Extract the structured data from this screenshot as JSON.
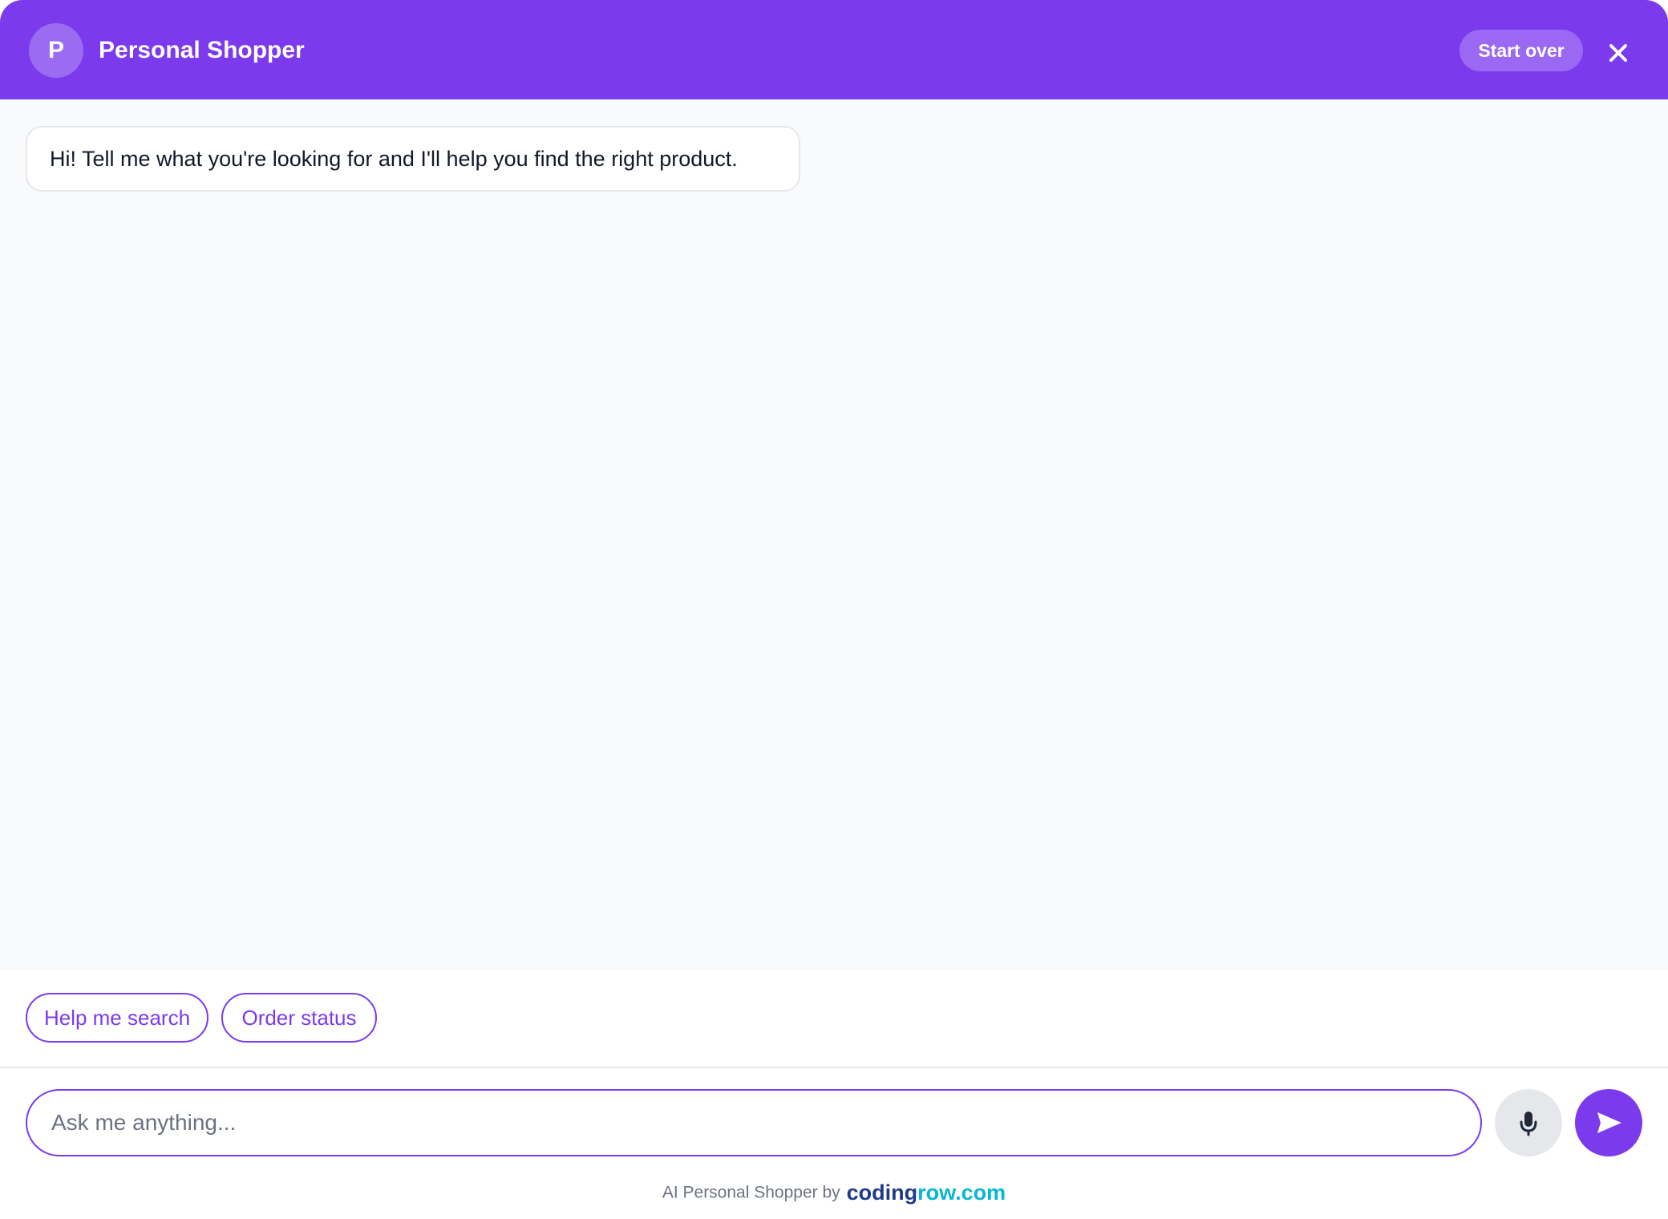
{
  "header": {
    "avatar_letter": "P",
    "title": "Personal Shopper",
    "start_over_label": "Start over",
    "close_icon": "close-icon"
  },
  "messages": [
    {
      "role": "assistant",
      "text": "Hi! Tell me what you're looking for and I'll help you find the right product."
    }
  ],
  "quick_replies": [
    {
      "label": "Help me search"
    },
    {
      "label": "Order status"
    }
  ],
  "composer": {
    "placeholder": "Ask me anything...",
    "mic_icon": "microphone-icon",
    "send_icon": "send-icon"
  },
  "footer": {
    "text": "AI Personal Shopper by",
    "brand_part1": "coding",
    "brand_part2": "row.com"
  },
  "colors": {
    "accent": "#7c3aed",
    "brand_dark": "#1e3a8a",
    "brand_light": "#06b6d4"
  }
}
